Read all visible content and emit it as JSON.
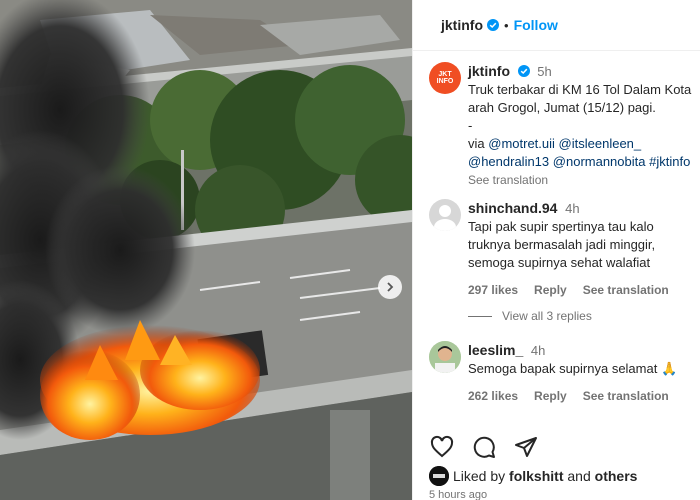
{
  "media": {
    "alt_icon": "burning-truck-photo"
  },
  "header": {
    "username": "jktinfo",
    "separator": "•",
    "follow_label": "Follow",
    "verified_color": "#0095f6"
  },
  "caption": {
    "avatar_text": "JKT INFO",
    "avatar_color": "#f04e23",
    "username": "jktinfo",
    "time": "5h",
    "line1": "Truk terbakar di KM 16 Tol Dalam Kota arah Grogol, Jumat (15/12) pagi.",
    "dash": "-",
    "via": "via",
    "mentions": [
      "@motret.uii",
      "@itsleenleen_",
      "@hendralin13",
      "@normannobita",
      "#jktinfo"
    ],
    "see_translation": "See translation"
  },
  "comments": [
    {
      "username": "shinchand.94",
      "time": "4h",
      "text": "Tapi pak supir spertinya tau kalo truknya bermasalah jadi minggir, semoga supirnya sehat walafiat",
      "likes": "297 likes",
      "reply": "Reply",
      "see_translation": "See translation",
      "view_replies": "View all 3 replies"
    },
    {
      "username": "leeslim_",
      "time": "4h",
      "text": "Semoga bapak supirnya selamat 🙏",
      "likes": "262 likes",
      "reply": "Reply",
      "see_translation": "See translation"
    }
  ],
  "footer": {
    "liked_prefix": "Liked by",
    "liked_user": "folkshitt",
    "liked_and": "and",
    "liked_others": "others",
    "time_ago": "5 hours ago",
    "actions": [
      "heart-icon",
      "comment-icon",
      "share-icon"
    ]
  }
}
